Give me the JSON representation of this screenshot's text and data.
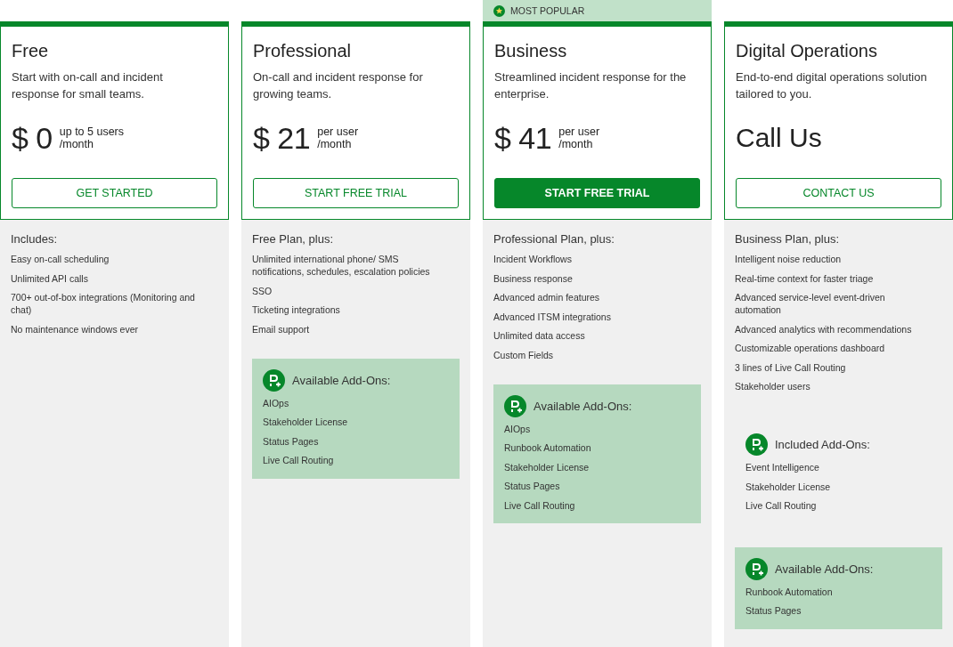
{
  "plans": [
    {
      "name": "Free",
      "description": "Start with on-call and incident response for small teams.",
      "price": {
        "kind": "amount",
        "currency": "$",
        "amount": "0",
        "unit_lines": [
          "up to 5 users",
          "/month"
        ]
      },
      "button": {
        "label": "GET STARTED",
        "kind": "outline"
      },
      "features_heading": "Includes:",
      "features": [
        "Easy on-call scheduling",
        "Unlimited API calls",
        "700+ out-of-box integrations (Monitoring and chat)",
        "No maintenance windows ever"
      ]
    },
    {
      "name": "Professional",
      "description": "On-call and incident response for growing teams.",
      "price": {
        "kind": "amount",
        "currency": "$",
        "amount": "21",
        "unit_lines": [
          "per user",
          "/month"
        ]
      },
      "button": {
        "label": "START FREE TRIAL",
        "kind": "outline"
      },
      "features_heading": "Free Plan, plus:",
      "features": [
        "Unlimited international phone/ SMS notifications, schedules, escalation policies",
        "SSO",
        "Ticketing integrations",
        "Email support"
      ],
      "addon_groups": [
        {
          "kind": "available",
          "title": "Available Add-Ons:",
          "items": [
            "AIOps",
            "Stakeholder License",
            "Status Pages",
            "Live Call Routing"
          ]
        }
      ]
    },
    {
      "badge": "MOST POPULAR",
      "name": "Business",
      "description": "Streamlined incident response for the enterprise.",
      "price": {
        "kind": "amount",
        "currency": "$",
        "amount": "41",
        "unit_lines": [
          "per user",
          "/month"
        ]
      },
      "button": {
        "label": "START FREE TRIAL",
        "kind": "filled"
      },
      "features_heading": "Professional Plan, plus:",
      "features": [
        "Incident Workflows",
        "Business response",
        "Advanced admin features",
        "Advanced ITSM integrations",
        "Unlimited data access",
        "Custom Fields"
      ],
      "addon_groups": [
        {
          "kind": "available",
          "title": "Available Add-Ons:",
          "items": [
            "AIOps",
            "Runbook Automation",
            "Stakeholder License",
            "Status Pages",
            "Live Call Routing"
          ]
        }
      ]
    },
    {
      "name": "Digital Operations",
      "description": "End-to-end digital operations solution tailored to you.",
      "price": {
        "kind": "text",
        "text": "Call Us"
      },
      "button": {
        "label": "CONTACT US",
        "kind": "outline"
      },
      "features_heading": "Business Plan, plus:",
      "features": [
        "Intelligent noise reduction",
        "Real-time context for faster triage",
        "Advanced service-level event-driven automation",
        "Advanced analytics with recommendations",
        "Customizable operations dashboard",
        "3 lines of Live Call Routing",
        "Stakeholder users"
      ],
      "addon_groups": [
        {
          "kind": "included",
          "title": "Included Add-Ons:",
          "items": [
            "Event Intelligence",
            "Stakeholder License",
            "Live Call Routing"
          ]
        },
        {
          "kind": "available",
          "title": "Available Add-Ons:",
          "items": [
            "Runbook Automation",
            "Status Pages"
          ]
        }
      ]
    }
  ]
}
